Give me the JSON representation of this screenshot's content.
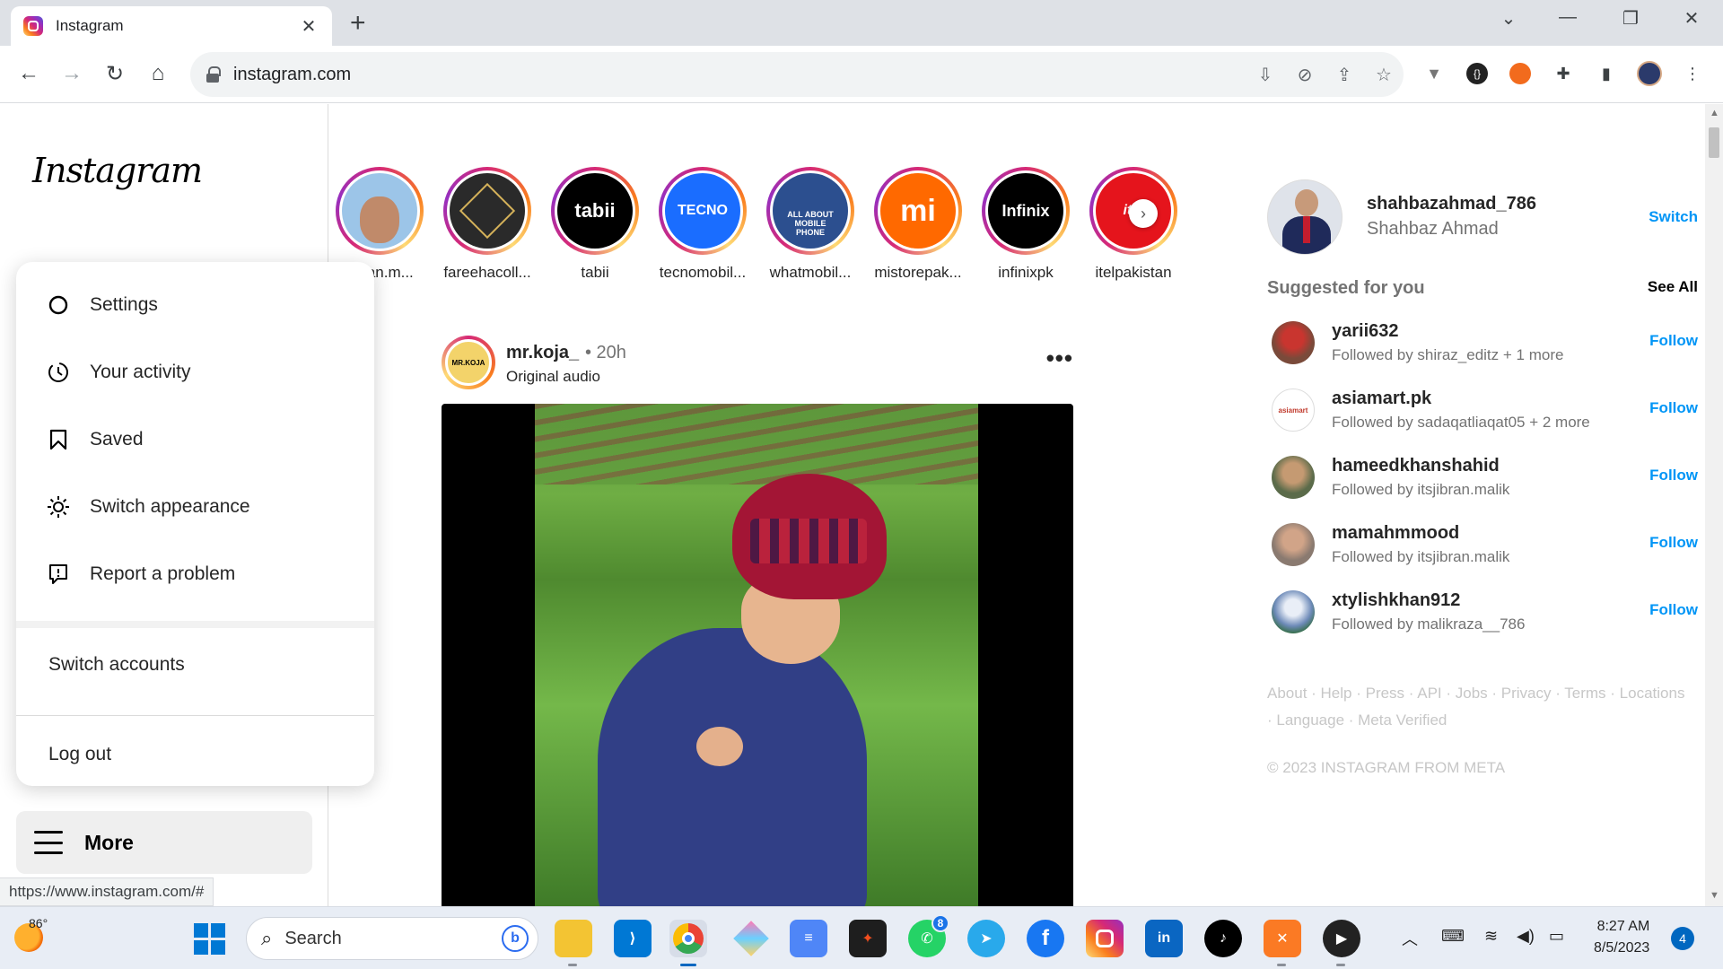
{
  "browser": {
    "tab_title": "Instagram",
    "url": "instagram.com",
    "status_url": "https://www.instagram.com/#"
  },
  "nav": {
    "logo": "Instagram",
    "more_label": "More"
  },
  "more_menu": {
    "items": [
      {
        "label": "Settings",
        "icon": "gear-icon"
      },
      {
        "label": "Your activity",
        "icon": "activity-icon"
      },
      {
        "label": "Saved",
        "icon": "bookmark-icon"
      },
      {
        "label": "Switch appearance",
        "icon": "sun-icon"
      },
      {
        "label": "Report a problem",
        "icon": "report-icon"
      }
    ],
    "switch_accounts": "Switch accounts",
    "log_out": "Log out"
  },
  "stories": [
    {
      "name": "imran.m...",
      "avatar_text": "",
      "color": "#9cc5e8"
    },
    {
      "name": "fareehacoll...",
      "avatar_text": "",
      "color": "#2a2a2a"
    },
    {
      "name": "tabii",
      "avatar_text": "tabii",
      "color": "#000000"
    },
    {
      "name": "tecnomobil...",
      "avatar_text": "TECNO",
      "color": "#1a6dff"
    },
    {
      "name": "whatmobil...",
      "avatar_text": "ALL ABOUT MOBILE PHONE",
      "color": "#2c4f8f"
    },
    {
      "name": "mistorepak...",
      "avatar_text": "mi",
      "color": "#ff6900"
    },
    {
      "name": "infinixpk",
      "avatar_text": "Infinix",
      "color": "#000000"
    },
    {
      "name": "itelpakistan",
      "avatar_text": "itel",
      "color": "#e5141c"
    }
  ],
  "post": {
    "username": "mr.koja_",
    "time": "• 20h",
    "audio": "Original audio",
    "avatar_text": "MR.KOJA"
  },
  "profile": {
    "username": "shahbazahmad_786",
    "full_name": "Shahbaz Ahmad",
    "switch_label": "Switch"
  },
  "suggestions": {
    "title": "Suggested for you",
    "see_all": "See All",
    "follow_label": "Follow",
    "items": [
      {
        "username": "yarii632",
        "sub": "Followed by shiraz_editz + 1 more",
        "color": "#7a4a3a"
      },
      {
        "username": "asiamart.pk",
        "sub": "Followed by sadaqatliaqat05 + 2 more",
        "color": "#ffffff"
      },
      {
        "username": "hameedkhanshahid",
        "sub": "Followed by itsjibran.malik",
        "color": "#5b6b4a"
      },
      {
        "username": "mamahmmood",
        "sub": "Followed by itsjibran.malik",
        "color": "#8a7a70"
      },
      {
        "username": "xtylishkhan912",
        "sub": "Followed by malikraza__786",
        "color": "#6d8ab8"
      }
    ]
  },
  "footer": {
    "links": "About · Help · Press · API · Jobs · Privacy · Terms · Locations · Language · Meta Verified",
    "copyright": "© 2023 INSTAGRAM FROM META"
  },
  "taskbar": {
    "temperature": "86°",
    "search_label": "Search",
    "whatsapp_badge": "8",
    "time": "8:27 AM",
    "date": "8/5/2023",
    "notifications": "4"
  }
}
